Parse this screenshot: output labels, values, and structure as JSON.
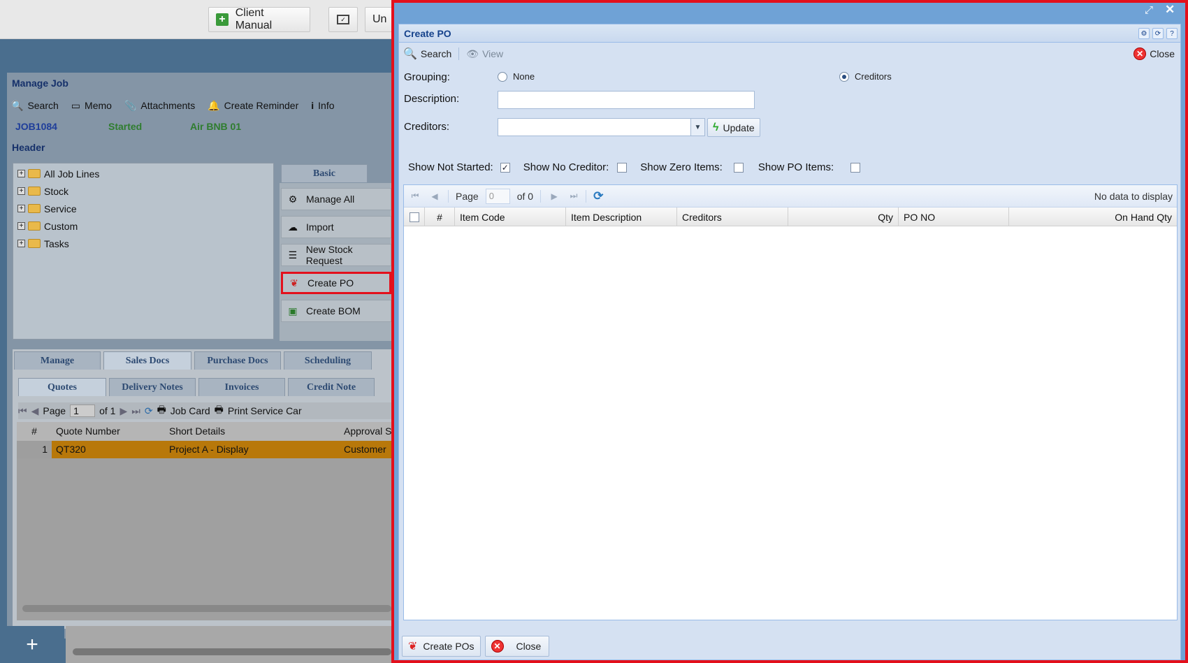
{
  "background": {
    "topbar": {
      "client_manual": "Client Manual",
      "truncated_btn": "Un"
    },
    "manage_job": {
      "title": "Manage Job",
      "toolbar": [
        "Search",
        "Memo",
        "Attachments",
        "Create Reminder",
        "Info"
      ],
      "job_no": "JOB1084",
      "status": "Started",
      "job_name": "Air BNB 01",
      "header_label": "Header",
      "tree": [
        "All Job Lines",
        "Stock",
        "Service",
        "Custom",
        "Tasks"
      ],
      "basic_tab": "Basic",
      "side_buttons": [
        "Manage All",
        "Import",
        "New Stock Request",
        "Create PO",
        "Create BOM"
      ],
      "main_tabs": [
        "Manage",
        "Sales Docs",
        "Purchase Docs",
        "Scheduling"
      ],
      "sub_tabs": [
        "Quotes",
        "Delivery Notes",
        "Invoices",
        "Credit Note"
      ],
      "pager": {
        "page_label": "Page",
        "page_value": "1",
        "of": "of 1",
        "job_card": "Job Card",
        "print": "Print Service Car"
      },
      "grid_headers": [
        "#",
        "Quote Number",
        "Short Details",
        "Approval S"
      ],
      "grid_row": {
        "num": "1",
        "quote": "QT320",
        "details": "Project A - Display",
        "approval": "Customer"
      },
      "add_symbol": "+"
    }
  },
  "modal": {
    "title": "Create PO",
    "toolbar": {
      "search": "Search",
      "view": "View",
      "close": "Close"
    },
    "grouping_label": "Grouping:",
    "grouping_options": {
      "none": "None",
      "creditors": "Creditors"
    },
    "grouping_selected": "Creditors",
    "description_label": "Description:",
    "description_value": "",
    "creditors_label": "Creditors:",
    "creditors_value": "",
    "update_label": "Update",
    "checks": [
      {
        "label": "Show Not Started:",
        "checked": true
      },
      {
        "label": "Show No Creditor:",
        "checked": false
      },
      {
        "label": "Show Zero Items:",
        "checked": false
      },
      {
        "label": "Show PO Items:",
        "checked": false
      }
    ],
    "pager": {
      "page_label": "Page",
      "page_value": "0",
      "of": "of 0",
      "empty": "No data to display"
    },
    "columns": [
      "#",
      "Item Code",
      "Item Description",
      "Creditors",
      "Qty",
      "PO NO",
      "On Hand Qty"
    ],
    "footer": {
      "create": "Create POs",
      "close": "Close"
    }
  },
  "colors": {
    "highlight_border": "#e3101c",
    "quote_row": "#b8780a",
    "accent": "#15428b"
  }
}
